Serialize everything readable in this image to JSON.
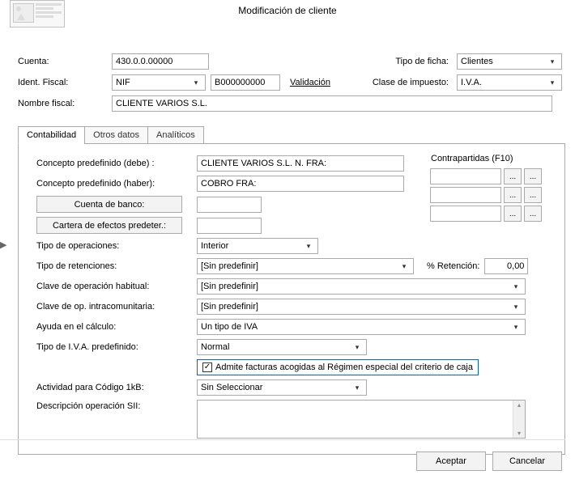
{
  "title": "Modificación de cliente",
  "top": {
    "cuenta_label": "Cuenta:",
    "cuenta_value": "430.0.0.00000",
    "tipo_ficha_label": "Tipo de ficha:",
    "tipo_ficha_value": "Clientes",
    "ident_fiscal_label": "Ident. Fiscal:",
    "ident_fiscal_type": "NIF",
    "ident_fiscal_value": "B000000000",
    "validacion": "Validación",
    "clase_impuesto_label": "Clase de impuesto:",
    "clase_impuesto_value": "I.V.A.",
    "nombre_fiscal_label": "Nombre fiscal:",
    "nombre_fiscal_value": "CLIENTE VARIOS S.L."
  },
  "tabs": {
    "t0": "Contabilidad",
    "t1": "Otros datos",
    "t2": "Analíticos"
  },
  "contab": {
    "concepto_debe_label": "Concepto predefinido (debe) :",
    "concepto_debe_value": "CLIENTE VARIOS S.L. N. FRA:",
    "concepto_haber_label": "Concepto predefinido (haber):",
    "concepto_haber_value": "COBRO FRA:",
    "cuenta_banco_label": "Cuenta de banco:",
    "cuenta_banco_value": "",
    "cartera_label": "Cartera de efectos predeter.:",
    "cartera_value": "",
    "tipo_oper_label": "Tipo de operaciones:",
    "tipo_oper_value": "Interior",
    "tipo_ret_label": "Tipo de retenciones:",
    "tipo_ret_value": "[Sin predefinir]",
    "pct_ret_label": "% Retención:",
    "pct_ret_value": "0,00",
    "clave_hab_label": "Clave de operación habitual:",
    "clave_hab_value": "[Sin predefinir]",
    "clave_intra_label": "Clave de op. intracomunitaria:",
    "clave_intra_value": "[Sin predefinir]",
    "ayuda_calc_label": "Ayuda en el cálculo:",
    "ayuda_calc_value": "Un tipo de IVA",
    "tipo_iva_label": "Tipo de I.V.A. predefinido:",
    "tipo_iva_value": "Normal",
    "checkbox_label": "Admite facturas acogidas al Régimen especial del criterio de caja",
    "actividad_label": "Actividad para Código 1kB:",
    "actividad_value": "Sin Seleccionar",
    "desc_sii_label": "Descripción operación SII:",
    "contrapartidas_title": "Contrapartidas (F10)",
    "dots": "..."
  },
  "footer": {
    "aceptar": "Aceptar",
    "cancelar": "Cancelar"
  }
}
